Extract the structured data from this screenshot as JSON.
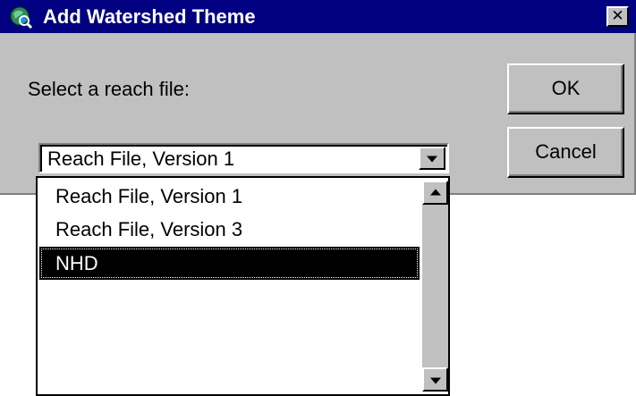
{
  "window": {
    "title": "Add Watershed Theme",
    "close_label": "✕",
    "icon": "globe-app-icon"
  },
  "prompt": "Select a reach file:",
  "buttons": {
    "ok": "OK",
    "cancel": "Cancel"
  },
  "combo": {
    "selected_value": "Reach File, Version 1"
  },
  "list": {
    "items": [
      {
        "label": "Reach File, Version 1",
        "selected": false
      },
      {
        "label": "Reach File, Version 3",
        "selected": false
      },
      {
        "label": "NHD",
        "selected": true
      }
    ]
  },
  "colors": {
    "titlebar": "#000080",
    "face": "#c0c0c0",
    "selection": "#000000"
  }
}
